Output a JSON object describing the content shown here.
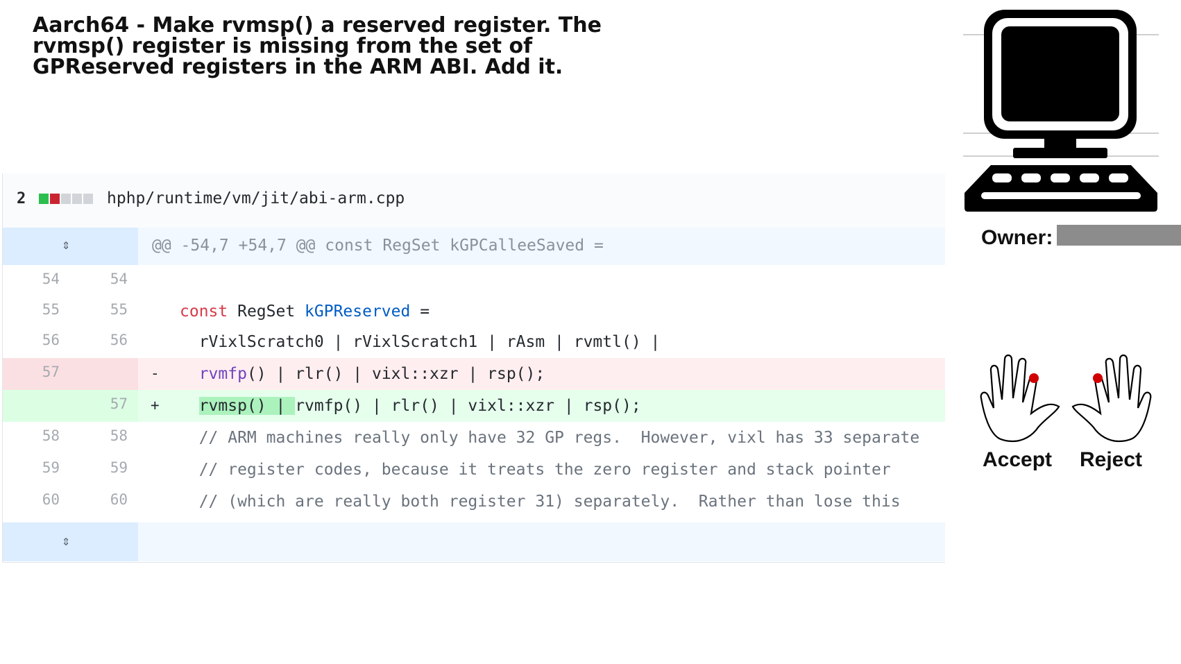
{
  "title": "Aarch64 - Make rvmsp() a reserved register. The rvmsp() register is missing from the set of GPReserved registers in the ARM ABI. Add it.",
  "file": {
    "change_count": "2",
    "path": "hphp/runtime/vm/jit/abi-arm.cpp",
    "diffstat_colors": [
      "#2cbe4e",
      "#cb2431",
      "#d1d5da",
      "#d1d5da",
      "#d1d5da"
    ]
  },
  "hunk_header": "@@ -54,7 +54,7 @@ const RegSet kGPCalleeSaved =",
  "lines": [
    {
      "old": "54",
      "new": "54",
      "marker": ""
    },
    {
      "old": "55",
      "new": "55",
      "marker": "",
      "kw": "const",
      "type": " RegSet ",
      "ident": "kGPReserved",
      "rest": " ="
    },
    {
      "old": "56",
      "new": "56",
      "marker": "",
      "text": "  rVixlScratch0 | rVixlScratch1 | rAsm | rvmtl() |"
    },
    {
      "old": "57",
      "new": "",
      "marker": "-",
      "fn": "rvmfp",
      "rest": "() | rlr() | vixl::xzr | rsp();"
    },
    {
      "old": "",
      "new": "57",
      "marker": "+",
      "highlight": "rvmsp() | ",
      "rest": "rvmfp() | rlr() | vixl::xzr | rsp();"
    },
    {
      "old": "58",
      "new": "58",
      "marker": "",
      "comment": "  // ARM machines really only have 32 GP regs.  However, vixl has 33 separate"
    },
    {
      "old": "59",
      "new": "59",
      "marker": "",
      "comment": "  // register codes, because it treats the zero register and stack pointer"
    },
    {
      "old": "60",
      "new": "60",
      "marker": "",
      "comment": "  // (which are really both register 31) separately.  Rather than lose this"
    }
  ],
  "owner_label": "Owner:",
  "accept_label": "Accept",
  "reject_label": "Reject",
  "icons": {
    "computer": "computer-icon",
    "accept": "hand-left-icon",
    "reject": "hand-right-icon",
    "expand_up": "expand-up-icon",
    "expand_down": "expand-down-icon"
  }
}
